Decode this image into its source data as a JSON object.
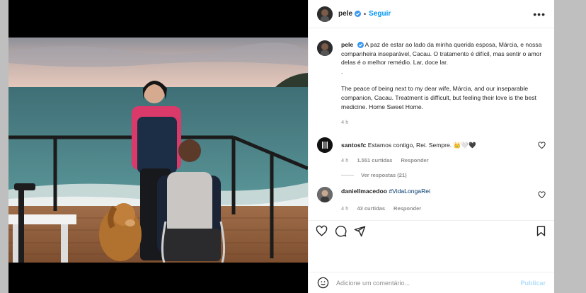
{
  "post": {
    "username": "pele",
    "follow_label": "Seguir",
    "more_label": "•••",
    "caption_pt": "A paz de estar ao lado da minha querida esposa, Márcia, e nossa companheira inseparável, Cacau. O tratamento é difícil, mas sentir o amor delas é o melhor remédio. Lar, doce lar.",
    "caption_sep": ".",
    "caption_en": "The peace of being next to my dear wife, Márcia, and our inseparable companion, Cacau. Treatment is difficult, but feeling their love is the best medicine. Home Sweet Home.",
    "time": "4 h"
  },
  "comments": [
    {
      "username": "santosfc",
      "text": "Estamos contigo, Rei. Sempre. 👑🤍🖤",
      "time": "4 h",
      "likes": "1.551 curtidas",
      "reply": "Responder",
      "view_replies": "Ver respostas (21)"
    },
    {
      "username": "daniellmacedoo",
      "text": "#VidaLongaRei",
      "time": "4 h",
      "likes": "43 curtidas",
      "reply": "Responder"
    }
  ],
  "composer": {
    "placeholder": "Adicione um comentário...",
    "publish_label": "Publicar"
  },
  "colors": {
    "link": "#0095f6",
    "verified": "#3897f0",
    "muted": "#8e8e8e"
  },
  "icons": [
    "heart-icon",
    "comment-icon",
    "share-icon",
    "bookmark-icon",
    "emoji-icon",
    "verified-icon",
    "more-icon"
  ]
}
